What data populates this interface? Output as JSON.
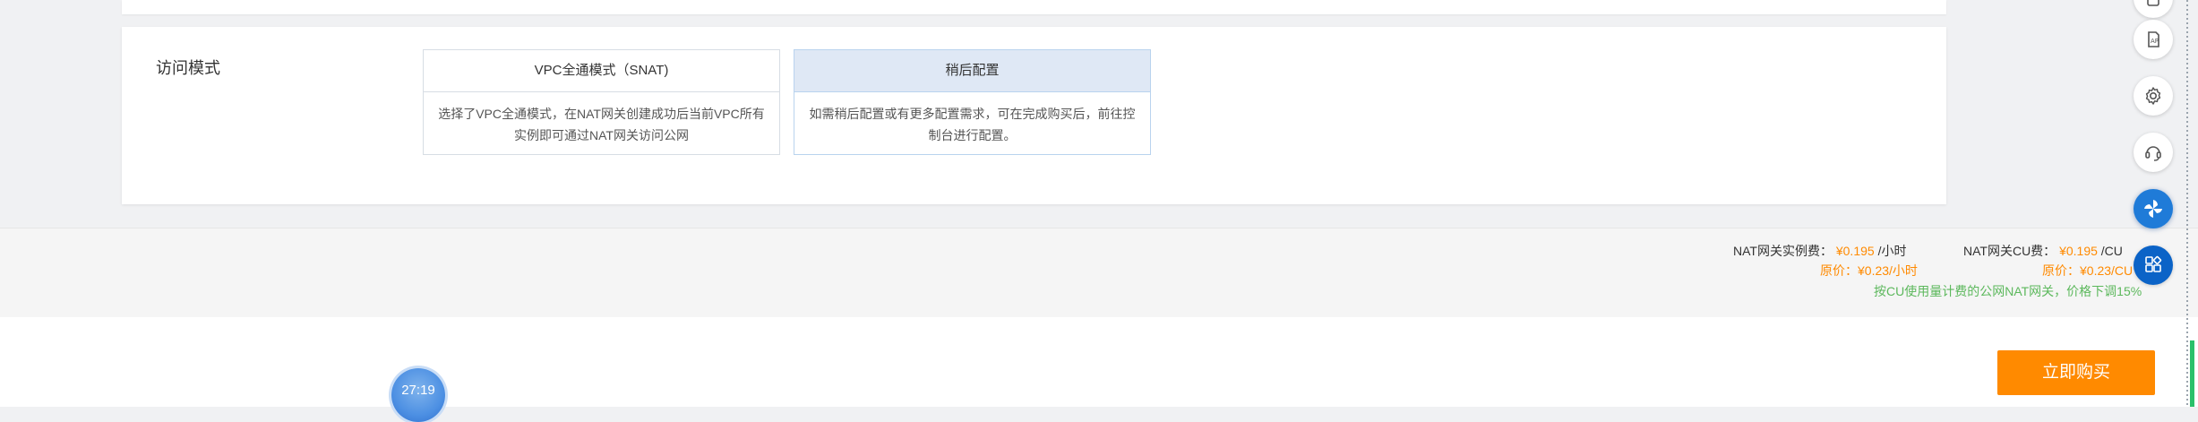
{
  "access_mode": {
    "label": "访问模式",
    "options": [
      {
        "title": "VPC全通模式（SNAT)",
        "desc": "选择了VPC全通模式，在NAT网关创建成功后当前VPC所有实例即可通过NAT网关访问公网",
        "selected": false
      },
      {
        "title": "稍后配置",
        "desc": "如需稍后配置或有更多配置需求，可在完成购买后，前往控制台进行配置。",
        "selected": true
      }
    ]
  },
  "pricing": {
    "instance_fee_label": "NAT网关实例费：",
    "instance_fee_price": "¥0.195",
    "instance_fee_unit": "/小时",
    "instance_original": "原价：¥0.23/小时",
    "cu_fee_label": "NAT网关CU费：",
    "cu_fee_price": "¥0.195",
    "cu_fee_unit": "/CU",
    "cu_original": "原价：¥0.23/CU",
    "promo": "按CU使用量计费的公网NAT网关，价格下调15%"
  },
  "buy_button_label": "立即购买",
  "timer_text": "27:19",
  "colors": {
    "accent_orange": "#ff8a00",
    "selected_header": "#dfe8f5",
    "promo_green": "#5cb85c",
    "float_blue": "#1f7bd8"
  },
  "floating_icons": [
    "document-icon",
    "api-icon",
    "gear-icon",
    "headset-icon",
    "pinwheel-icon",
    "apps-icon"
  ]
}
